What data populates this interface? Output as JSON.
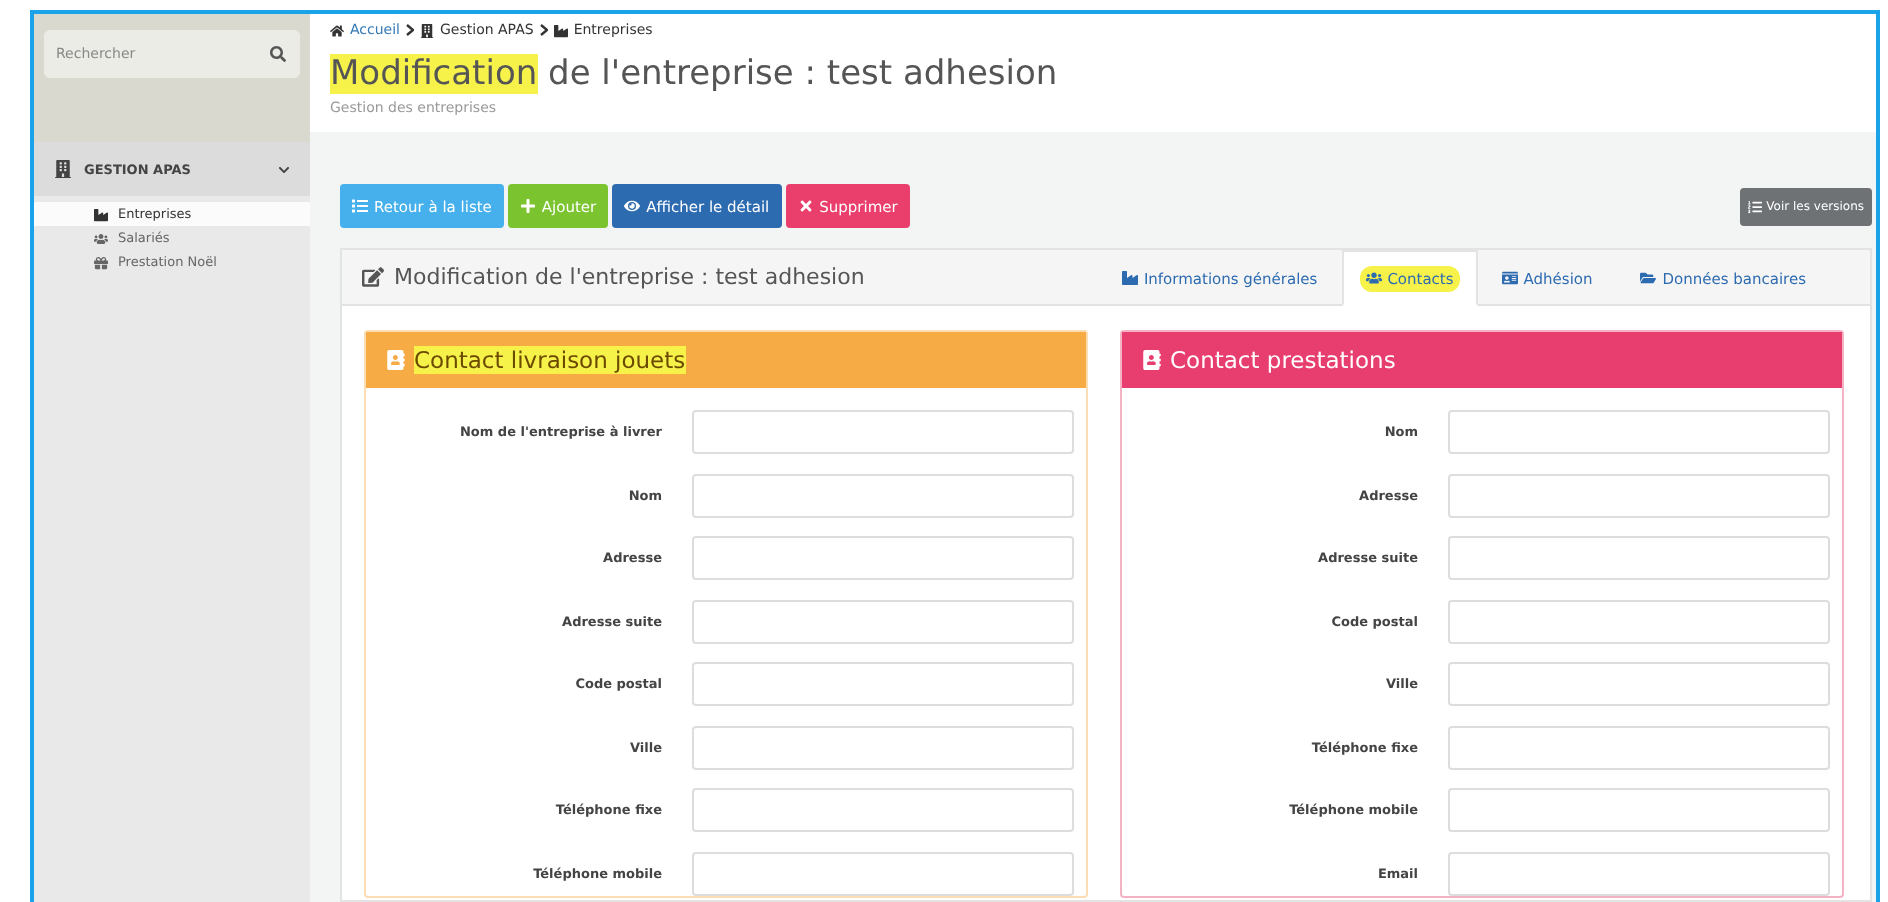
{
  "sidebar": {
    "search": {
      "placeholder": "Rechercher"
    },
    "section": {
      "label": "GESTION APAS",
      "expanded": true
    },
    "items": [
      {
        "label": "Entreprises",
        "selected": true
      },
      {
        "label": "Salariés",
        "selected": false
      },
      {
        "label": "Prestation Noël",
        "selected": false
      }
    ]
  },
  "breadcrumb": [
    {
      "label": "Accueil",
      "link": true
    },
    {
      "label": "Gestion APAS",
      "link": false
    },
    {
      "label": "Entreprises",
      "link": false
    }
  ],
  "title": [
    {
      "text": "Modification",
      "highlighted": true
    },
    {
      "text": " de l'entreprise : test adhesion",
      "highlighted": false
    }
  ],
  "subtitle": "Gestion des entreprises",
  "actions": [
    {
      "label": "Retour à la liste",
      "kind": "info"
    },
    {
      "label": "Ajouter",
      "kind": "success"
    },
    {
      "label": "Afficher le détail",
      "kind": "primary"
    },
    {
      "label": "Supprimer",
      "kind": "danger"
    }
  ],
  "versions_button": {
    "label": "Voir les versions"
  },
  "card": {
    "title": "Modification de l'entreprise : test adhesion",
    "tabs": [
      {
        "label": "Informations générales",
        "selected": false,
        "highlighted": false
      },
      {
        "label": "Contacts",
        "selected": true,
        "highlighted": true
      },
      {
        "label": "Adhésion",
        "selected": false,
        "highlighted": false
      },
      {
        "label": "Données bancaires",
        "selected": false,
        "highlighted": false
      }
    ]
  },
  "panels": [
    {
      "title": "Contact livraison jouets",
      "color": "#f7ab44",
      "highlighted": true,
      "fields": [
        "Nom de l'entreprise à livrer",
        "Nom",
        "Adresse",
        "Adresse suite",
        "Code postal",
        "Ville",
        "Téléphone fixe",
        "Téléphone mobile"
      ]
    },
    {
      "title": "Contact prestations",
      "color": "#e83e6f",
      "highlighted": false,
      "fields": [
        "Nom",
        "Adresse",
        "Adresse suite",
        "Code postal",
        "Ville",
        "Téléphone fixe",
        "Téléphone mobile",
        "Email"
      ]
    }
  ]
}
